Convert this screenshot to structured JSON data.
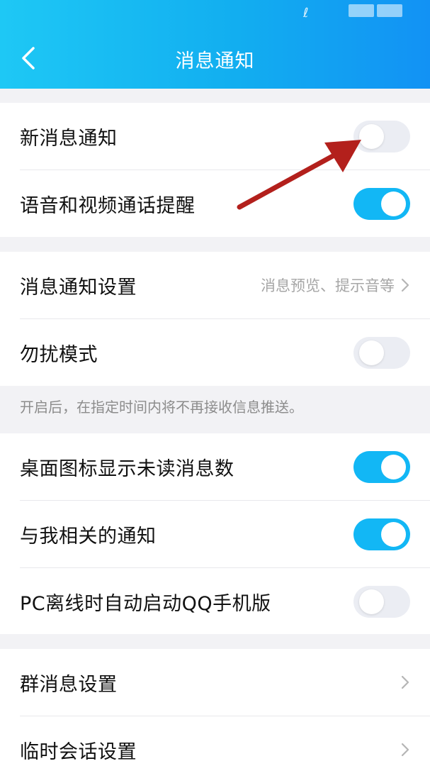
{
  "header": {
    "title": "消息通知",
    "status_icon": "ℓ"
  },
  "group1": {
    "new_message": {
      "label": "新消息通知",
      "on": false
    },
    "voice_video": {
      "label": "语音和视频通话提醒",
      "on": true
    }
  },
  "group2": {
    "notify_settings": {
      "label": "消息通知设置",
      "value": "消息预览、提示音等"
    },
    "dnd": {
      "label": "勿扰模式",
      "on": false
    }
  },
  "hint": "开启后，在指定时间内将不再接收信息推送。",
  "group3": {
    "badge": {
      "label": "桌面图标显示未读消息数",
      "on": true
    },
    "related": {
      "label": "与我相关的通知",
      "on": true
    },
    "pc_offline": {
      "label": "PC离线时自动启动QQ手机版",
      "on": false
    }
  },
  "group4": {
    "group_msg": {
      "label": "群消息设置"
    },
    "temp_chat": {
      "label": "临时会话设置"
    }
  },
  "colors": {
    "accent": "#12b7f5",
    "annotation_arrow": "#b3201c"
  }
}
